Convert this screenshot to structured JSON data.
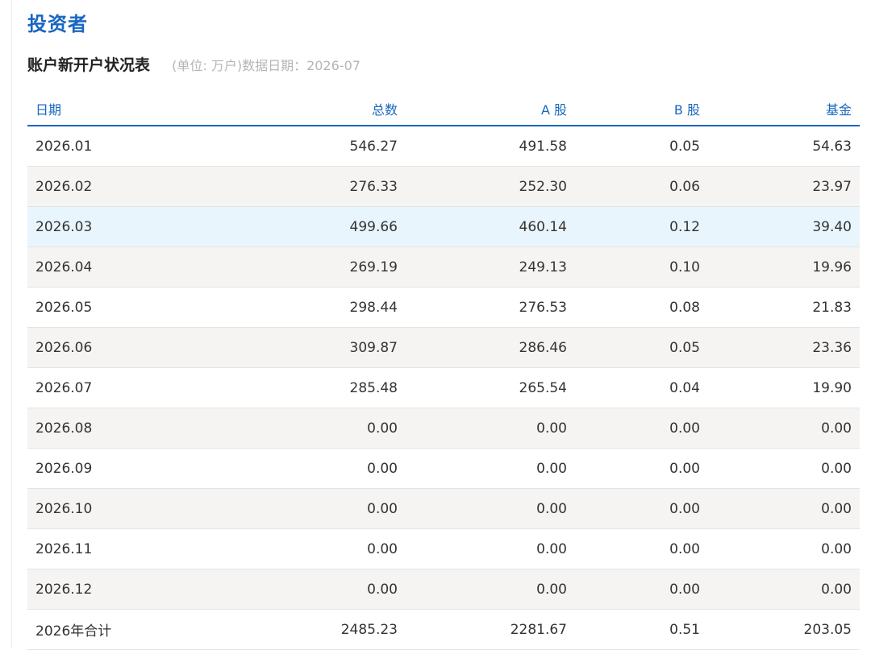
{
  "page": {
    "title": "投资者"
  },
  "section": {
    "title": "账户新开户状况表",
    "subtitle": "(单位: 万户)数据日期：2026-07"
  },
  "table": {
    "headers": [
      "日期",
      "总数",
      "A 股",
      "B 股",
      "基金"
    ],
    "rows": [
      [
        "2026.01",
        "546.27",
        "491.58",
        "0.05",
        "54.63"
      ],
      [
        "2026.02",
        "276.33",
        "252.30",
        "0.06",
        "23.97"
      ],
      [
        "2026.03",
        "499.66",
        "460.14",
        "0.12",
        "39.40"
      ],
      [
        "2026.04",
        "269.19",
        "249.13",
        "0.10",
        "19.96"
      ],
      [
        "2026.05",
        "298.44",
        "276.53",
        "0.08",
        "21.83"
      ],
      [
        "2026.06",
        "309.87",
        "286.46",
        "0.05",
        "23.36"
      ],
      [
        "2026.07",
        "285.48",
        "265.54",
        "0.04",
        "19.90"
      ],
      [
        "2026.08",
        "0.00",
        "0.00",
        "0.00",
        "0.00"
      ],
      [
        "2026.09",
        "0.00",
        "0.00",
        "0.00",
        "0.00"
      ],
      [
        "2026.10",
        "0.00",
        "0.00",
        "0.00",
        "0.00"
      ],
      [
        "2026.11",
        "0.00",
        "0.00",
        "0.00",
        "0.00"
      ],
      [
        "2026.12",
        "0.00",
        "0.00",
        "0.00",
        "0.00"
      ],
      [
        "2026年合计",
        "2485.23",
        "2281.67",
        "0.51",
        "203.05"
      ]
    ],
    "highlight_row": 2
  },
  "colors": {
    "accent": "#1867c0",
    "stripe": "#f5f4f2",
    "highlight": "#e9f5fc",
    "subtitle": "#b5b5b5"
  }
}
